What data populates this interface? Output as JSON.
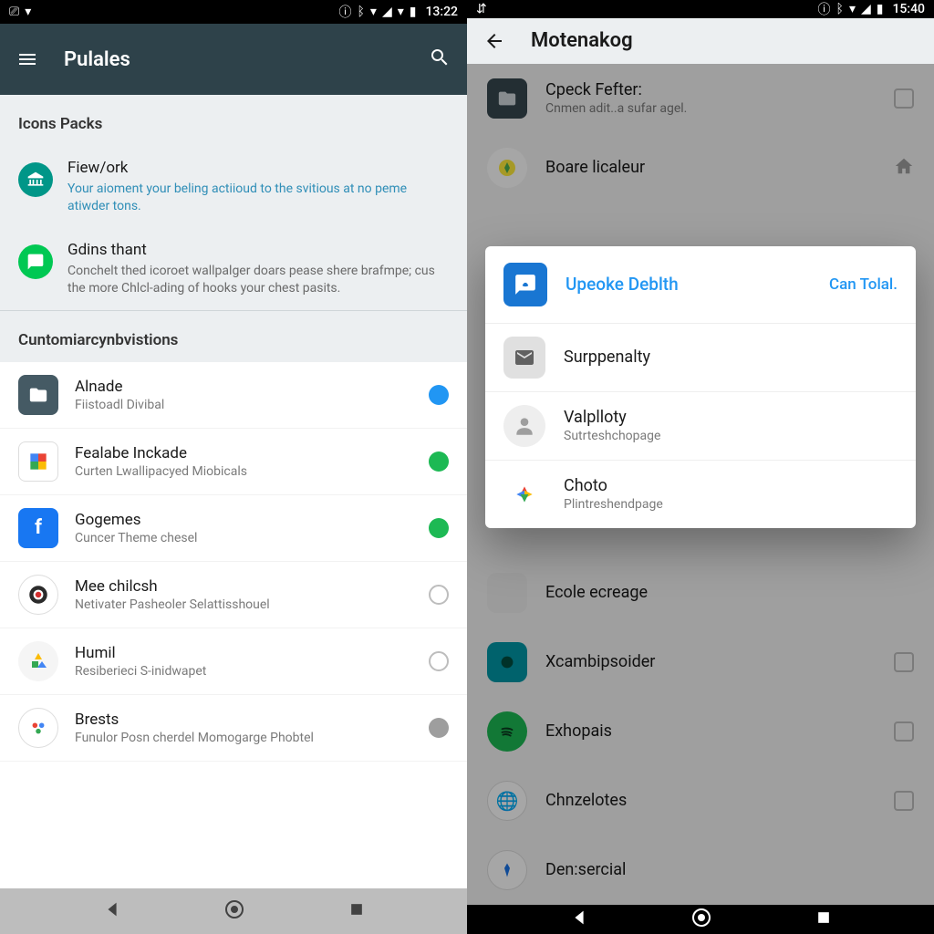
{
  "left": {
    "status": {
      "time": "13:22"
    },
    "toolbar": {
      "title": "Pulales"
    },
    "section1": {
      "header": "Icons Packs"
    },
    "packs": [
      {
        "title": "Fiew/ork",
        "desc": "Your aioment your beling actiioud to the svitious at no peme atiwder tons."
      },
      {
        "title": "Gdins thant",
        "desc": "Conchelt thed icoroet wallpalger doars pease shere brafmpe; cus the more Chlcl-ading of hooks your chest pasits."
      }
    ],
    "section2": {
      "header": "Cuntomiarcynbvistions"
    },
    "apps": [
      {
        "title": "Alnade",
        "sub": "Fiistoadl Divibal"
      },
      {
        "title": "Fealabe Inckade",
        "sub": "Curten Lwallipacyed Miobicals"
      },
      {
        "title": "Gogemes",
        "sub": "Cuncer Theme chesel"
      },
      {
        "title": "Mee chilcsh",
        "sub": "Netivater Pasheoler Selattisshouel"
      },
      {
        "title": "Humil",
        "sub": "Resiberieci S-inidwapet"
      },
      {
        "title": "Brests",
        "sub": "Funulor Posn cherdel Momogarge Phobtel"
      }
    ]
  },
  "right": {
    "status": {
      "time": "15:40"
    },
    "toolbar": {
      "title": "Motenakog"
    },
    "bg_items": [
      {
        "title": "Cpeck Fefter:",
        "sub": "Cnmen adit..a sufar agel."
      },
      {
        "title": "Boare licaleur",
        "sub": ""
      },
      {
        "title": "Ecole ecreage",
        "sub": ""
      },
      {
        "title": "Xcambipsoider",
        "sub": ""
      },
      {
        "title": "Exhopais",
        "sub": ""
      },
      {
        "title": "Chnzelotes",
        "sub": ""
      },
      {
        "title": "Den:sercial",
        "sub": ""
      }
    ],
    "dialog": {
      "title": "Upeoke Deblth",
      "action": "Can Tolal.",
      "items": [
        {
          "title": "Surppenalty",
          "sub": ""
        },
        {
          "title": "Valplloty",
          "sub": "Sutrteshchopage"
        },
        {
          "title": "Choto",
          "sub": "Plintreshendpage"
        }
      ]
    }
  }
}
